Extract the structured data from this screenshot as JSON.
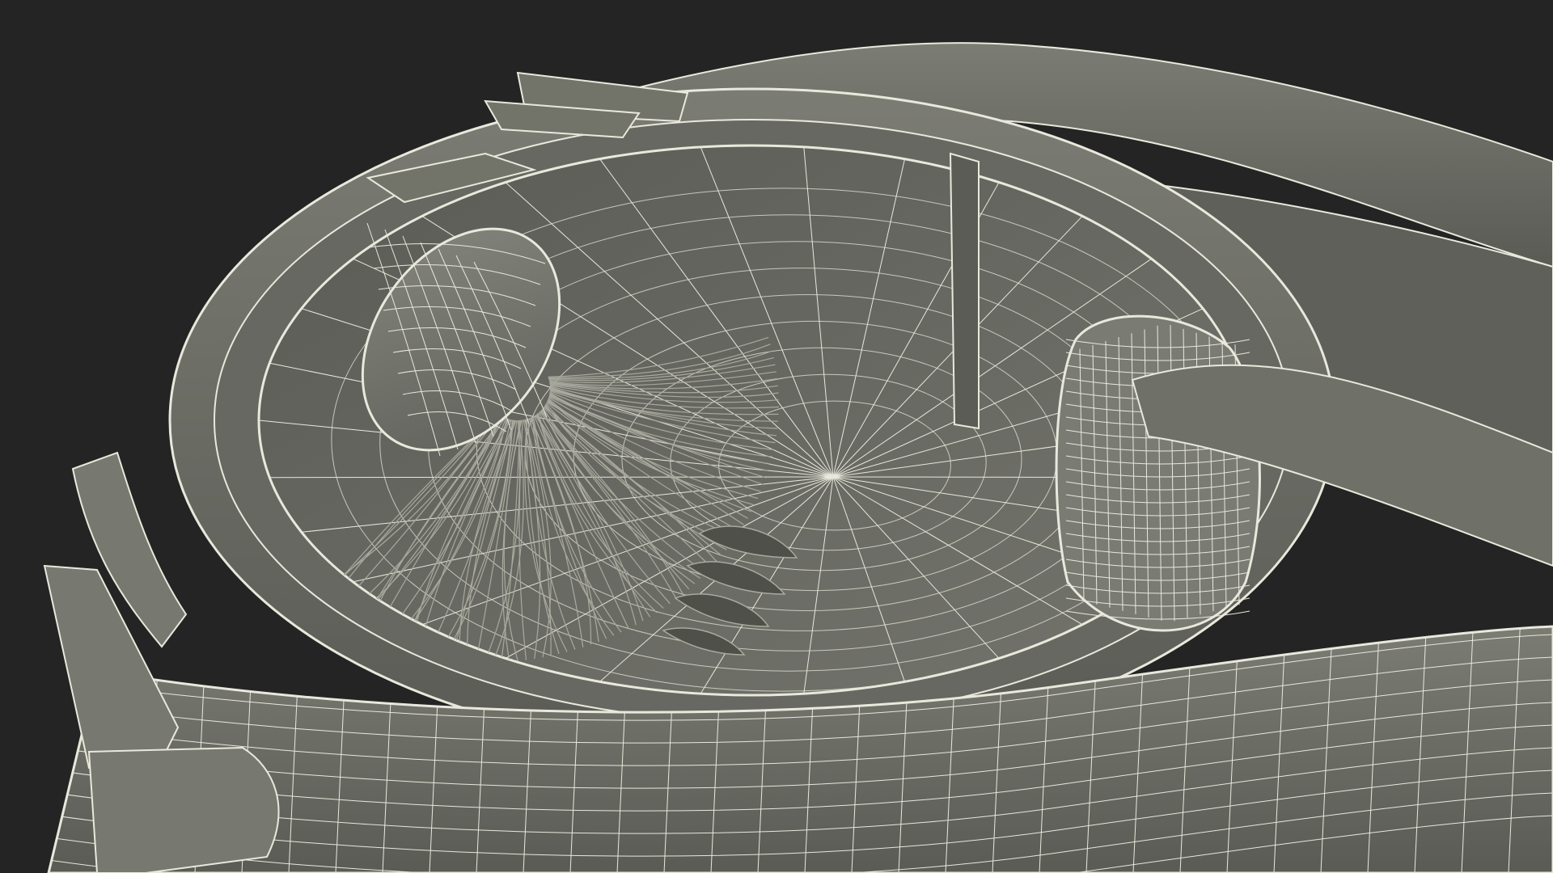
{
  "scene": {
    "subject": "eye-anatomy-wireframe-render",
    "colors": {
      "background": "#242424",
      "surface": "#6f7068",
      "surface_light": "#85867d",
      "surface_dark": "#4d4e48",
      "wire": "#e9e8dc",
      "fiber": "#a9a99e"
    }
  }
}
